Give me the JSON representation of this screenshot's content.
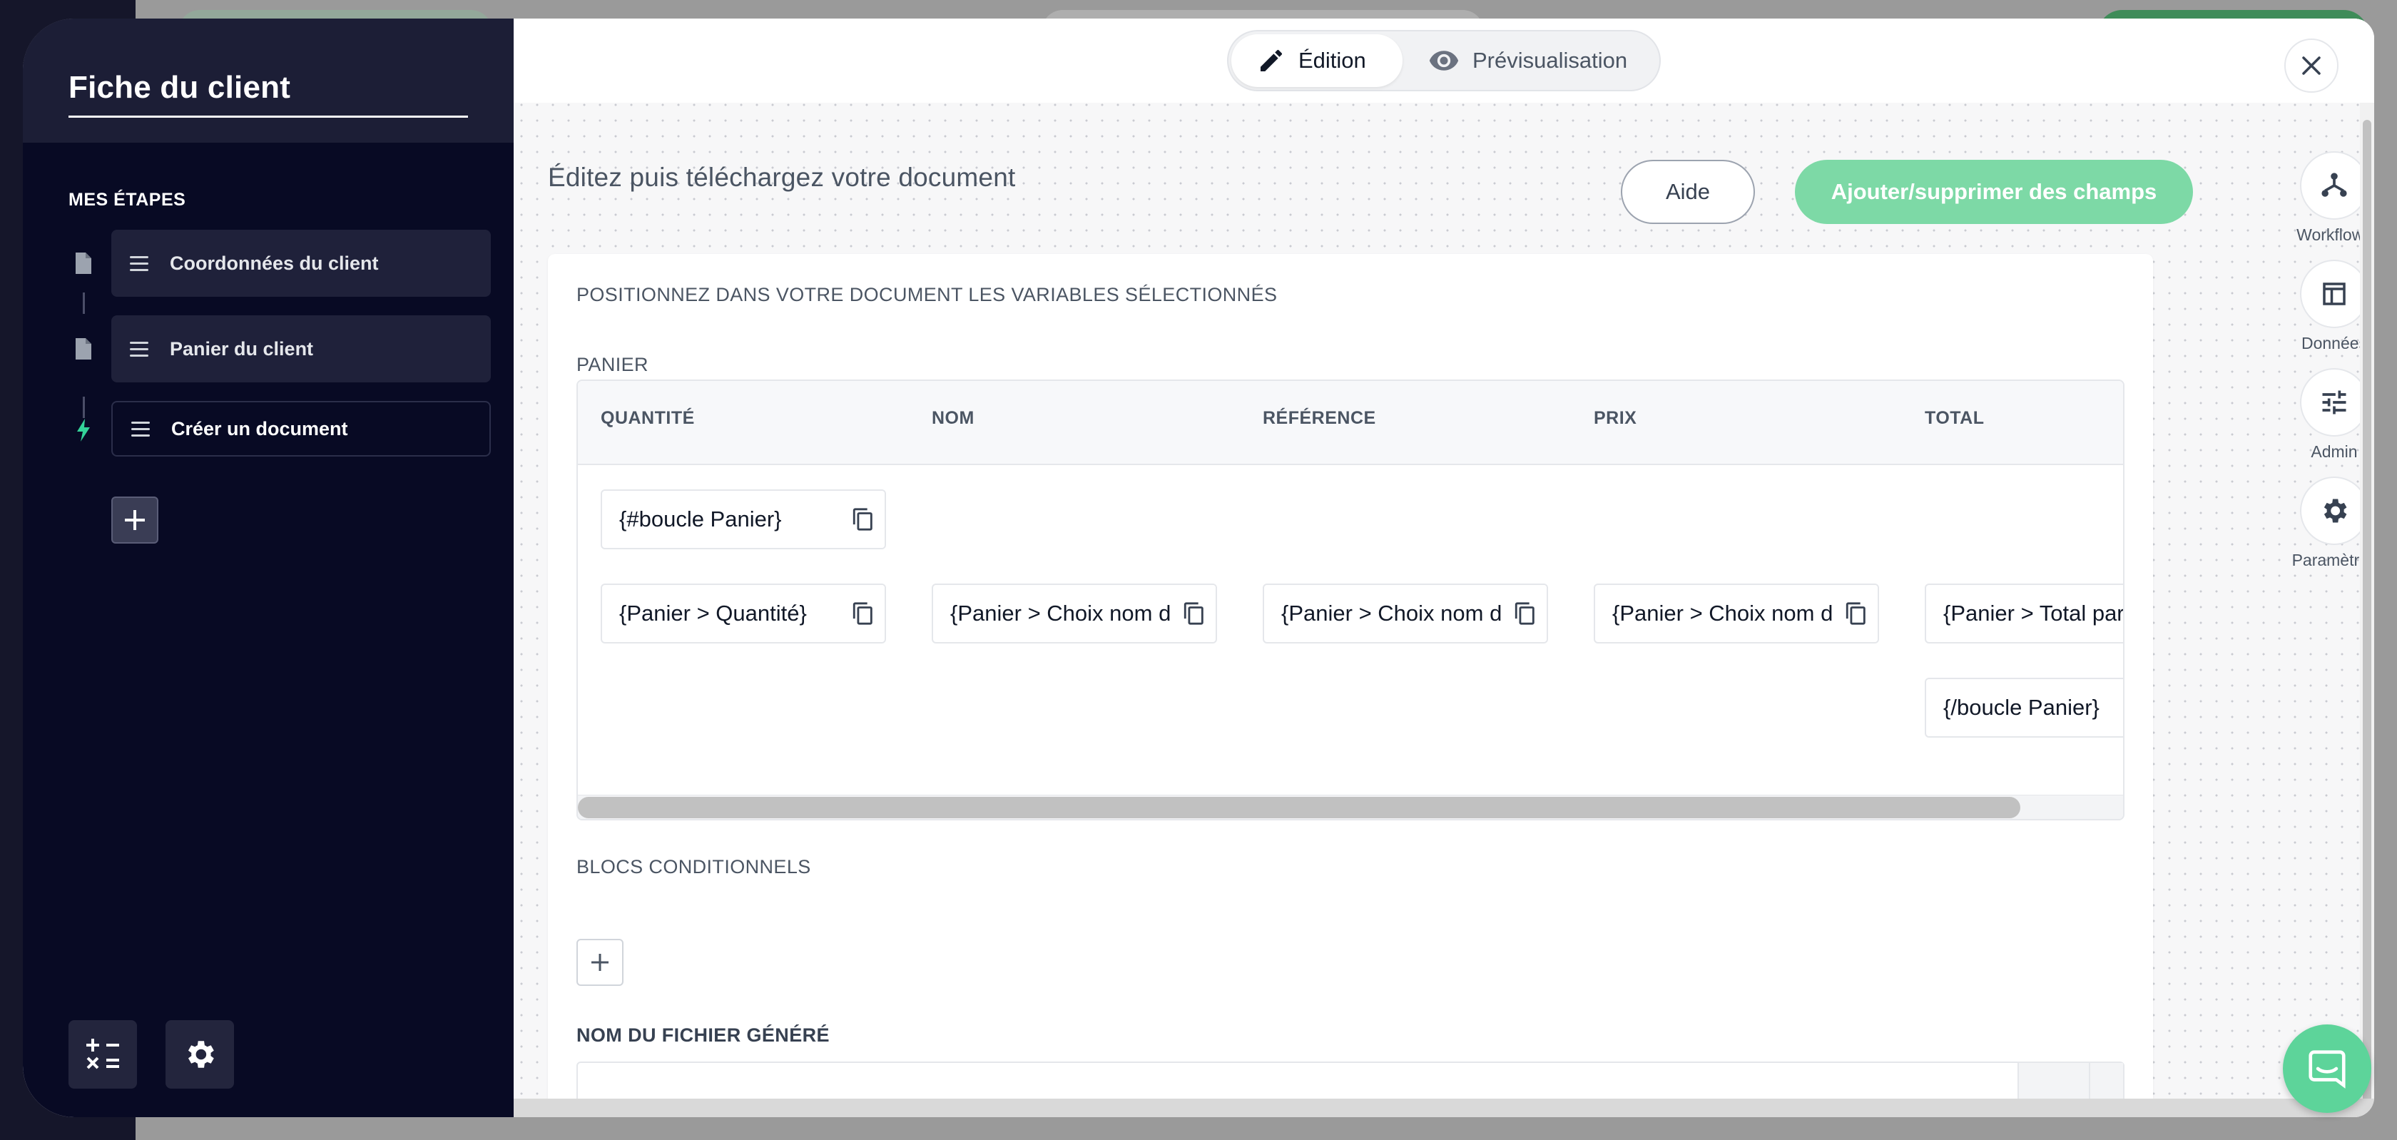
{
  "sidebar": {
    "title": "Fiche du client",
    "steps_label": "MES ÉTAPES",
    "steps": [
      {
        "label": "Coordonnées du client",
        "icon": "document-icon"
      },
      {
        "label": "Panier du client",
        "icon": "document-icon"
      },
      {
        "label": "Créer un document",
        "icon": "lightning-icon"
      }
    ]
  },
  "topbar": {
    "edit_label": "Édition",
    "preview_label": "Prévisualisation"
  },
  "main": {
    "headline": "Éditez puis téléchargez votre document",
    "help_label": "Aide",
    "add_fields_label": "Ajouter/supprimer des champs",
    "section_variables": "POSITIONNEZ DANS VOTRE DOCUMENT LES VARIABLES SÉLECTIONNÉS",
    "section_panier": "PANIER",
    "table": {
      "headers": [
        "QUANTITÉ",
        "NOM",
        "RÉFÉRENCE",
        "PRIX",
        "TOTAL"
      ],
      "loop_start": "{#boucle Panier}",
      "cells": [
        "{Panier > Quantité}",
        "{Panier > Choix nom d",
        "{Panier > Choix nom d",
        "{Panier > Choix nom d",
        "{Panier > Total par"
      ],
      "loop_end": "{/boucle Panier}"
    },
    "section_conditional": "BLOCS CONDITIONNELS",
    "section_filename": "NOM DU FICHIER GÉNÉRÉ"
  },
  "rail": [
    {
      "label": "Workflows",
      "icon": "workflow-icon"
    },
    {
      "label": "Données",
      "icon": "table-icon"
    },
    {
      "label": "Admin",
      "icon": "sliders-icon"
    },
    {
      "label": "Paramètres",
      "icon": "gear-icon"
    }
  ],
  "colors": {
    "accent_green": "#7dd9a6",
    "sidebar_bg": "#080a24",
    "chat_green": "#5dd49a"
  }
}
